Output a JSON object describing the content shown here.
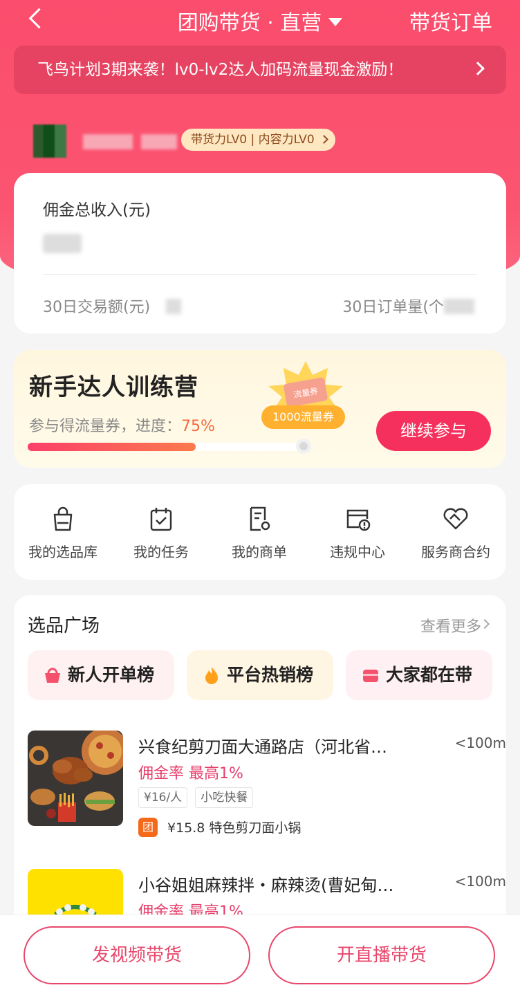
{
  "header": {
    "title": "团购带货 · 直营",
    "orders_label": "带货订单"
  },
  "announcement": {
    "text": "飞鸟计划3期来袭！lv0-lv2达人加码流量现金激励！"
  },
  "user": {
    "level_badge": "带货力LV0 | 内容力LV0"
  },
  "earnings": {
    "total_label": "佣金总收入(元)",
    "gmv_30d_label": "30日交易额(元)",
    "orders_30d_label": "30日订单量(个"
  },
  "campaign": {
    "title": "新手达人训练营",
    "subtitle": "参与得流量券，进度：",
    "progress_text": "75%",
    "progress": 0.75,
    "reward_bubble": "1000流量券",
    "coupon_text": "流量券",
    "cta": "继续参与"
  },
  "tools": [
    {
      "label": "我的选品库",
      "icon": "bag-icon"
    },
    {
      "label": "我的任务",
      "icon": "calendar-check-icon"
    },
    {
      "label": "我的商单",
      "icon": "document-gear-icon"
    },
    {
      "label": "违规中心",
      "icon": "warning-card-icon"
    },
    {
      "label": "服务商合约",
      "icon": "handshake-heart-icon"
    }
  ],
  "market": {
    "title": "选品广场",
    "more": "查看更多",
    "ranks": [
      {
        "label": "新人开单榜",
        "icon": "basket-icon",
        "color": "#f4516c"
      },
      {
        "label": "平台热销榜",
        "icon": "fire-icon",
        "color": "#ff9f1c"
      },
      {
        "label": "大家都在带",
        "icon": "box-icon",
        "color": "#f4516c"
      }
    ],
    "shops": [
      {
        "name": "兴食纪剪刀面大通路店（河北省…",
        "distance": "<100m",
        "commission": "佣金率 最高1%",
        "tags": [
          "¥16/人",
          "小吃快餐"
        ],
        "deal": "¥15.8 特色剪刀面小锅",
        "deal_icon": "团"
      },
      {
        "name": "小谷姐姐麻辣拌・麻辣烫(曹妃甸…",
        "distance": "<100m",
        "commission": "佣金率 最高1%"
      }
    ]
  },
  "bottom": {
    "video_btn": "发视频带货",
    "live_btn": "开直播带货"
  },
  "colors": {
    "brand": "#fb4d6d",
    "accent": "#f6305c",
    "commission": "#e83d6a"
  }
}
